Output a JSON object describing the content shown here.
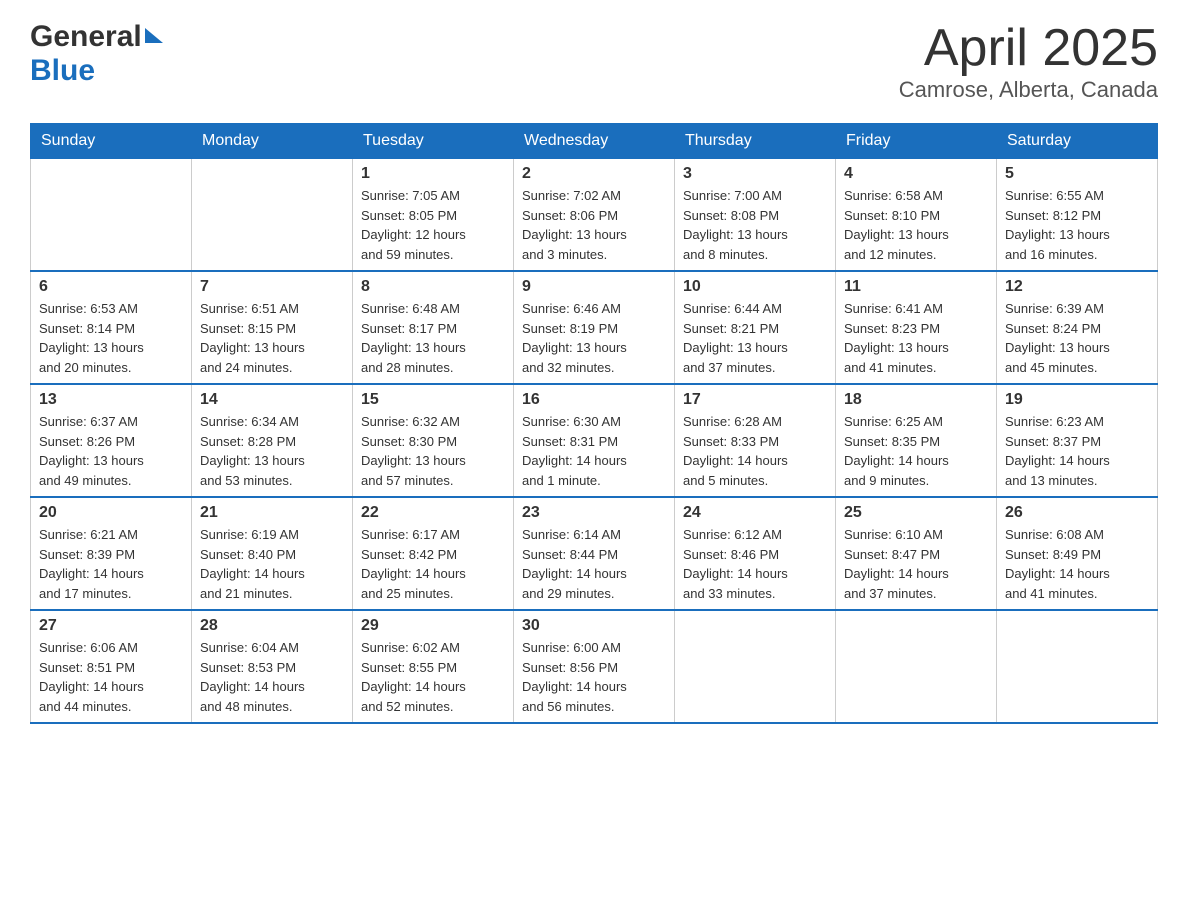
{
  "header": {
    "logo": {
      "general": "General",
      "blue": "Blue"
    },
    "title": "April 2025",
    "location": "Camrose, Alberta, Canada"
  },
  "days_of_week": [
    "Sunday",
    "Monday",
    "Tuesday",
    "Wednesday",
    "Thursday",
    "Friday",
    "Saturday"
  ],
  "weeks": [
    [
      {
        "day": "",
        "info": ""
      },
      {
        "day": "",
        "info": ""
      },
      {
        "day": "1",
        "info": "Sunrise: 7:05 AM\nSunset: 8:05 PM\nDaylight: 12 hours\nand 59 minutes."
      },
      {
        "day": "2",
        "info": "Sunrise: 7:02 AM\nSunset: 8:06 PM\nDaylight: 13 hours\nand 3 minutes."
      },
      {
        "day": "3",
        "info": "Sunrise: 7:00 AM\nSunset: 8:08 PM\nDaylight: 13 hours\nand 8 minutes."
      },
      {
        "day": "4",
        "info": "Sunrise: 6:58 AM\nSunset: 8:10 PM\nDaylight: 13 hours\nand 12 minutes."
      },
      {
        "day": "5",
        "info": "Sunrise: 6:55 AM\nSunset: 8:12 PM\nDaylight: 13 hours\nand 16 minutes."
      }
    ],
    [
      {
        "day": "6",
        "info": "Sunrise: 6:53 AM\nSunset: 8:14 PM\nDaylight: 13 hours\nand 20 minutes."
      },
      {
        "day": "7",
        "info": "Sunrise: 6:51 AM\nSunset: 8:15 PM\nDaylight: 13 hours\nand 24 minutes."
      },
      {
        "day": "8",
        "info": "Sunrise: 6:48 AM\nSunset: 8:17 PM\nDaylight: 13 hours\nand 28 minutes."
      },
      {
        "day": "9",
        "info": "Sunrise: 6:46 AM\nSunset: 8:19 PM\nDaylight: 13 hours\nand 32 minutes."
      },
      {
        "day": "10",
        "info": "Sunrise: 6:44 AM\nSunset: 8:21 PM\nDaylight: 13 hours\nand 37 minutes."
      },
      {
        "day": "11",
        "info": "Sunrise: 6:41 AM\nSunset: 8:23 PM\nDaylight: 13 hours\nand 41 minutes."
      },
      {
        "day": "12",
        "info": "Sunrise: 6:39 AM\nSunset: 8:24 PM\nDaylight: 13 hours\nand 45 minutes."
      }
    ],
    [
      {
        "day": "13",
        "info": "Sunrise: 6:37 AM\nSunset: 8:26 PM\nDaylight: 13 hours\nand 49 minutes."
      },
      {
        "day": "14",
        "info": "Sunrise: 6:34 AM\nSunset: 8:28 PM\nDaylight: 13 hours\nand 53 minutes."
      },
      {
        "day": "15",
        "info": "Sunrise: 6:32 AM\nSunset: 8:30 PM\nDaylight: 13 hours\nand 57 minutes."
      },
      {
        "day": "16",
        "info": "Sunrise: 6:30 AM\nSunset: 8:31 PM\nDaylight: 14 hours\nand 1 minute."
      },
      {
        "day": "17",
        "info": "Sunrise: 6:28 AM\nSunset: 8:33 PM\nDaylight: 14 hours\nand 5 minutes."
      },
      {
        "day": "18",
        "info": "Sunrise: 6:25 AM\nSunset: 8:35 PM\nDaylight: 14 hours\nand 9 minutes."
      },
      {
        "day": "19",
        "info": "Sunrise: 6:23 AM\nSunset: 8:37 PM\nDaylight: 14 hours\nand 13 minutes."
      }
    ],
    [
      {
        "day": "20",
        "info": "Sunrise: 6:21 AM\nSunset: 8:39 PM\nDaylight: 14 hours\nand 17 minutes."
      },
      {
        "day": "21",
        "info": "Sunrise: 6:19 AM\nSunset: 8:40 PM\nDaylight: 14 hours\nand 21 minutes."
      },
      {
        "day": "22",
        "info": "Sunrise: 6:17 AM\nSunset: 8:42 PM\nDaylight: 14 hours\nand 25 minutes."
      },
      {
        "day": "23",
        "info": "Sunrise: 6:14 AM\nSunset: 8:44 PM\nDaylight: 14 hours\nand 29 minutes."
      },
      {
        "day": "24",
        "info": "Sunrise: 6:12 AM\nSunset: 8:46 PM\nDaylight: 14 hours\nand 33 minutes."
      },
      {
        "day": "25",
        "info": "Sunrise: 6:10 AM\nSunset: 8:47 PM\nDaylight: 14 hours\nand 37 minutes."
      },
      {
        "day": "26",
        "info": "Sunrise: 6:08 AM\nSunset: 8:49 PM\nDaylight: 14 hours\nand 41 minutes."
      }
    ],
    [
      {
        "day": "27",
        "info": "Sunrise: 6:06 AM\nSunset: 8:51 PM\nDaylight: 14 hours\nand 44 minutes."
      },
      {
        "day": "28",
        "info": "Sunrise: 6:04 AM\nSunset: 8:53 PM\nDaylight: 14 hours\nand 48 minutes."
      },
      {
        "day": "29",
        "info": "Sunrise: 6:02 AM\nSunset: 8:55 PM\nDaylight: 14 hours\nand 52 minutes."
      },
      {
        "day": "30",
        "info": "Sunrise: 6:00 AM\nSunset: 8:56 PM\nDaylight: 14 hours\nand 56 minutes."
      },
      {
        "day": "",
        "info": ""
      },
      {
        "day": "",
        "info": ""
      },
      {
        "day": "",
        "info": ""
      }
    ]
  ]
}
